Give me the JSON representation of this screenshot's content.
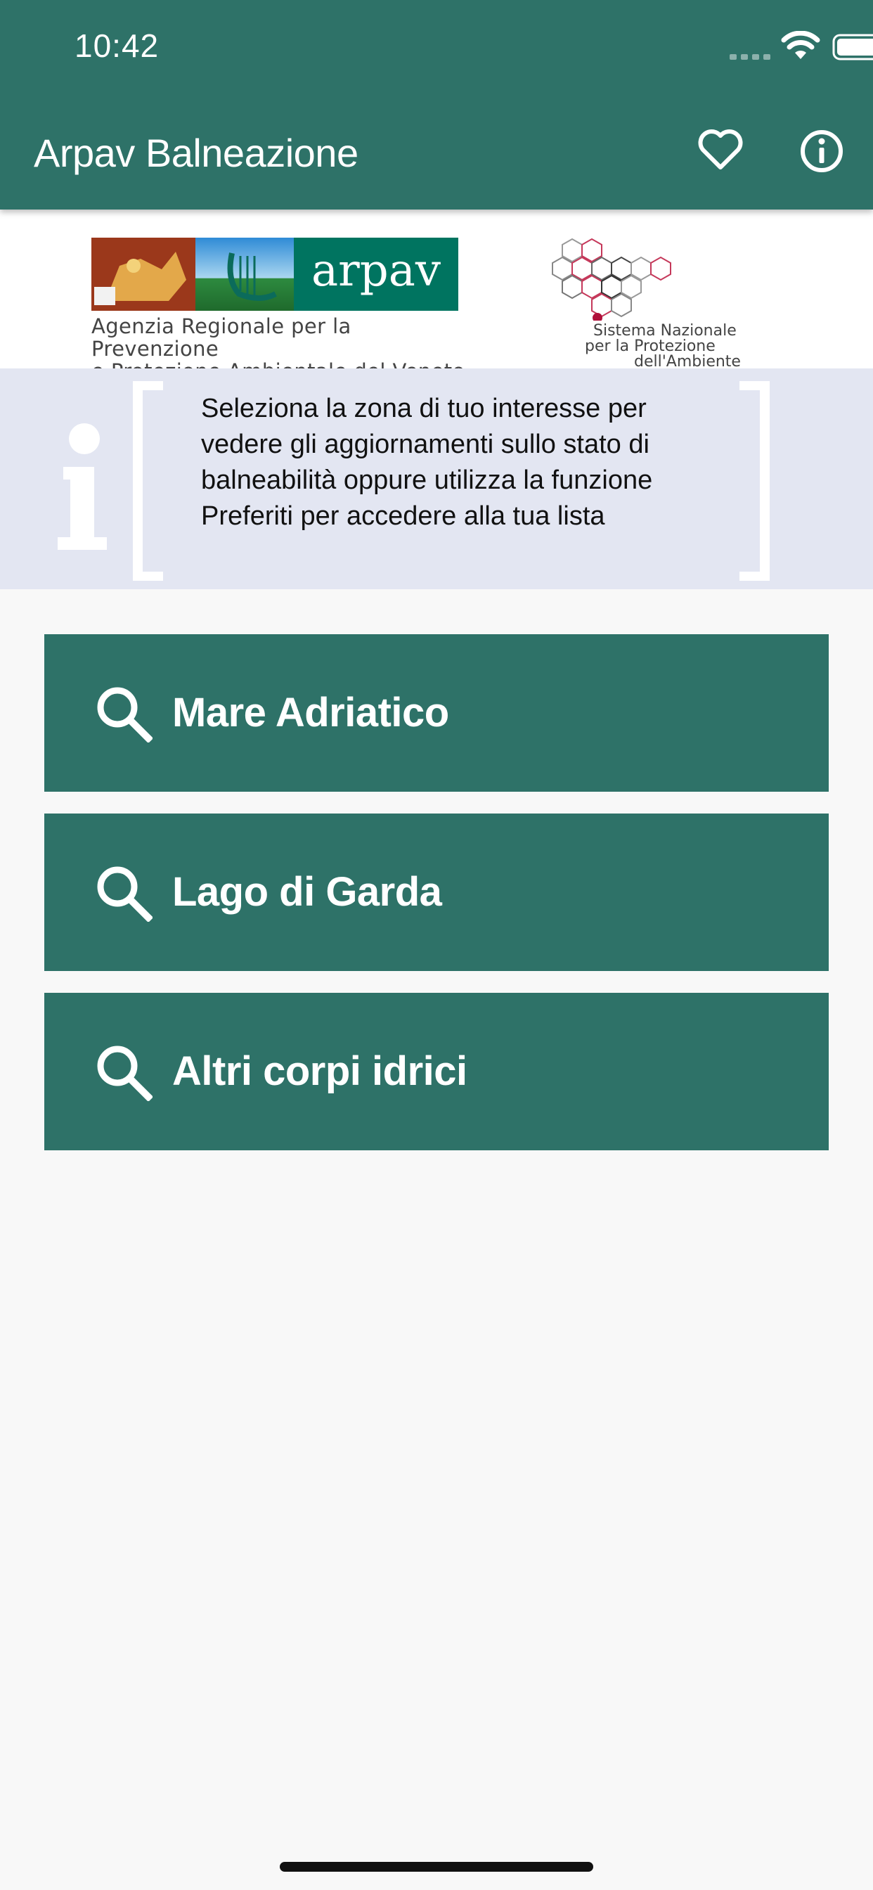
{
  "status_bar": {
    "time": "10:42"
  },
  "app_bar": {
    "title": "Arpav Balneazione",
    "favorites_icon": "heart-outline-icon",
    "info_icon": "info-circle-icon"
  },
  "logos": {
    "arpav_wordmark": "arpav",
    "arpav_caption_line1": "Agenzia Regionale per la Prevenzione",
    "arpav_caption_line2": "e Protezione Ambientale del Veneto",
    "snpa_line1": "Sistema Nazionale",
    "snpa_line2": "per la Protezione",
    "snpa_line3": "dell'Ambiente"
  },
  "info_banner": {
    "text": "Seleziona la zona di tuo interesse per vedere gli aggiornamenti sullo stato di balneabilità oppure utilizza la funzione Preferiti per accedere alla tua lista"
  },
  "zones": [
    {
      "label": "Mare Adriatico",
      "icon": "search-icon"
    },
    {
      "label": "Lago di Garda",
      "icon": "search-icon"
    },
    {
      "label": "Altri corpi idrici",
      "icon": "search-icon"
    }
  ],
  "colors": {
    "primary": "#2e7268",
    "banner_background": "#e3e6f2",
    "page_background": "#f8f8f8"
  }
}
